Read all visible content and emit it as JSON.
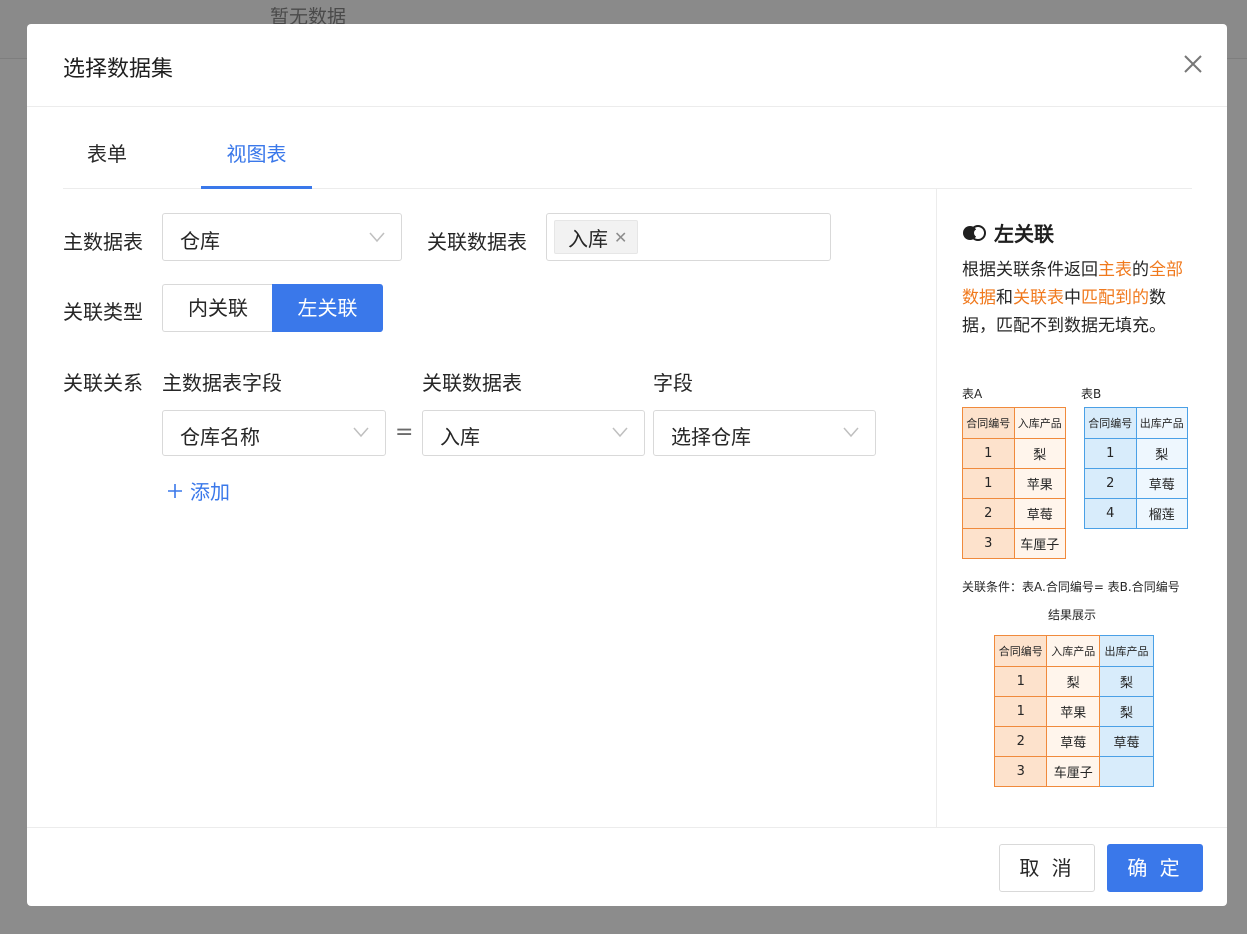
{
  "background": {
    "empty_text": "暂无数据"
  },
  "dialog": {
    "title": "选择数据集"
  },
  "tabs": [
    {
      "label": "表单"
    },
    {
      "label": "视图表",
      "active": true
    }
  ],
  "form": {
    "main_table_label": "主数据表",
    "main_table_value": "仓库",
    "related_table_label": "关联数据表",
    "related_tag": "入库",
    "join_type_label": "关联类型",
    "join_types": [
      "内关联",
      "左关联"
    ],
    "join_type_selected": "左关联",
    "relation_label": "关联关系",
    "col_main_field": "主数据表字段",
    "col_related_table": "关联数据表",
    "col_field": "字段",
    "row_main_field": "仓库名称",
    "eq": "=",
    "row_related_table": "入库",
    "row_field": "选择仓库",
    "add_label": "添加"
  },
  "explain": {
    "title": "左关联",
    "desc": {
      "p1": "根据关联条件返回",
      "hl1": "主表",
      "p2": "的",
      "hl2": "全部数据",
      "p3": "和",
      "hl3": "关联表",
      "p4": "中",
      "hl4": "匹配到的",
      "p5": "数据，匹配不到数据无填充。"
    },
    "table_a_label": "表A",
    "table_b_label": "表B",
    "table_a": {
      "headers": [
        "合同编号",
        "入库产品"
      ],
      "rows": [
        [
          "1",
          "梨"
        ],
        [
          "1",
          "苹果"
        ],
        [
          "2",
          "草莓"
        ],
        [
          "3",
          "车厘子"
        ]
      ]
    },
    "table_b": {
      "headers": [
        "合同编号",
        "出库产品"
      ],
      "rows": [
        [
          "1",
          "梨"
        ],
        [
          "2",
          "草莓"
        ],
        [
          "4",
          "榴莲"
        ]
      ]
    },
    "condition": "关联条件：表A.合同编号= 表B.合同编号",
    "result_label": "结果展示",
    "result": {
      "headers": [
        "合同编号",
        "入库产品",
        "出库产品"
      ],
      "rows": [
        [
          "1",
          "梨",
          "梨"
        ],
        [
          "1",
          "苹果",
          "梨"
        ],
        [
          "2",
          "草莓",
          "草莓"
        ],
        [
          "3",
          "车厘子",
          ""
        ]
      ]
    }
  },
  "footer": {
    "cancel": "取 消",
    "ok": "确 定"
  },
  "colors": {
    "primary": "#3a78ea",
    "highlight": "#f0791d",
    "table_a": "#f08a3c",
    "table_b": "#4aa0e6"
  }
}
